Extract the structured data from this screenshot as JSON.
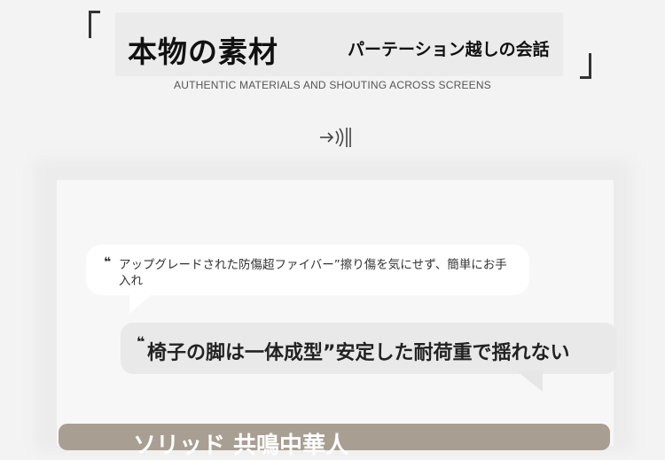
{
  "header": {
    "title_main": "本物の素材",
    "title_sub": "パーテーション越しの会話",
    "subtitle_en": "AUTHENTIC MATERIALS AND SHOUTING ACROSS SCREENS",
    "bracket_left": "「",
    "bracket_right": "」"
  },
  "icon": {
    "name": "arrow-right-sound-icon"
  },
  "bubbles": [
    {
      "quote": "❝",
      "text": "アップグレードされた防傷超ファイバー”擦り傷を気にせず、簡単にお手入れ"
    },
    {
      "quote": "❝",
      "text": "椅子の脚は一体成型”安定した耐荷重で揺れない"
    }
  ],
  "bottom_banner": {
    "text": "ソリッド  共鳴中華人"
  },
  "colors": {
    "background": "#f3f3f3",
    "card": "#f7f7f7",
    "bubble_primary": "#ffffff",
    "bubble_secondary": "#e9e9e9",
    "banner": "#a99e92",
    "text_dark": "#111111"
  }
}
